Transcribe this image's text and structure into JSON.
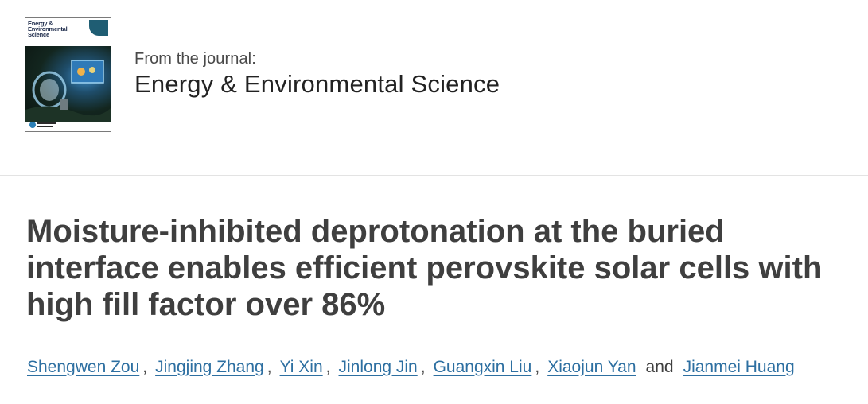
{
  "journal": {
    "from_label": "From the journal:",
    "name": "Energy & Environmental Science",
    "cover_title": "Energy & Environmental Science"
  },
  "article": {
    "title": "Moisture-inhibited deprotonation at the buried interface enables efficient perovskite solar cells with high fill factor over 86%"
  },
  "authors": {
    "list": [
      "Shengwen Zou",
      "Jingjing Zhang",
      "Yi Xin",
      "Jinlong Jin",
      "Guangxin Liu",
      "Xiaojun Yan",
      "Jianmei Huang"
    ],
    "separator": ",",
    "conjunction": "and"
  },
  "colors": {
    "link": "#2d6fa1",
    "title_text": "#3f3f3f",
    "divider": "#e3e3e3"
  }
}
